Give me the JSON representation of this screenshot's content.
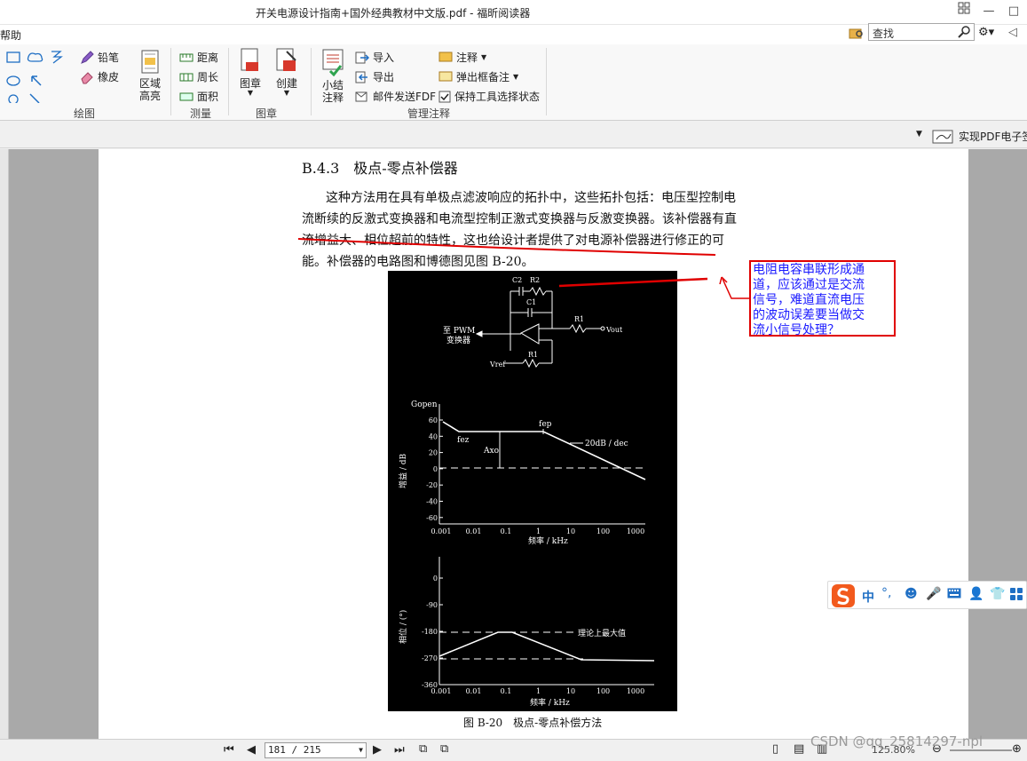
{
  "window": {
    "title": "开关电源设计指南+国外经典教材中文版.pdf - 福昕阅读器"
  },
  "menu": {
    "help": "帮助",
    "search_text": "查找"
  },
  "ribbon": {
    "draw_group": {
      "label": "绘图",
      "pencil": "铅笔",
      "eraser": "橡皮",
      "area_highlight": "区域\n高亮"
    },
    "measure_group": {
      "label": "测量",
      "distance": "距离",
      "perimeter": "周长",
      "area": "面积"
    },
    "stamp_group": {
      "label": "图章",
      "stamp": "图章",
      "create": "创建"
    },
    "manage_group": {
      "label": "管理注释",
      "summary": "小结\n注释",
      "import": "导入",
      "export": "导出",
      "send_email": "邮件发送FDF",
      "comment": "注释",
      "popup_note": "弹出框备注",
      "keep_tool": "保持工具选择状态"
    }
  },
  "toolbar2": {
    "sign_label": "实现PDF电子签"
  },
  "document": {
    "heading": "B.4.3　极点-零点补偿器",
    "paragraph_lines": [
      "这种方法用在具有单极点滤波响应的拓扑中，这些拓扑包括：电压型控制电",
      "流断续的反激式变换器和电流型控制正激式变换器与反激变换器。该补偿器有直",
      "流增益大、相位超前的特性，这也给设计者提供了对电源补偿器进行修正的可",
      "能。补偿器的电路图和博德图见图 B-20。"
    ],
    "figure_caption": "图 B-20　极点-零点补偿方法"
  },
  "figure": {
    "circuit": {
      "labels": {
        "c2": "C2",
        "r2": "R2",
        "c1": "C1",
        "r1": "R1",
        "r1b": "R1",
        "vout": "Vout",
        "vref": "Vref",
        "to_pwm": "至 PWM",
        "converter": "变换器"
      }
    },
    "gain_plot": {
      "ylabel": "增益 / dB",
      "xlabel": "频率 / kHz",
      "g_label": "Gopen",
      "fez": "fez",
      "fep": "fep",
      "axo": "Axo",
      "slope": "20dB / dec",
      "yticks": [
        "60",
        "40",
        "20",
        "0",
        "-20",
        "-40",
        "-60"
      ],
      "xticks": [
        "0.001",
        "0.01",
        "0.1",
        "1",
        "10",
        "100",
        "1000"
      ]
    },
    "phase_plot": {
      "ylabel": "相位 / (°)",
      "xlabel": "频率 / kHz",
      "theory_label": "理论上最大值",
      "yticks": [
        "0",
        "-90",
        "-180",
        "-270",
        "-360"
      ],
      "xticks": [
        "0.001",
        "0.01",
        "0.1",
        "1",
        "10",
        "100",
        "1000"
      ]
    }
  },
  "annotation": {
    "note_text": "电阻电容串联形成通道，应该通过是交流信号，难道直流电压的波动误差要当做交流小信号处理？",
    "note_lines": [
      "电阻电容串联形成通",
      "道，应该通过是交流",
      "信号，难道直流电压",
      "的波动误差要当做交",
      "流小信号处理？"
    ],
    "color": "#e00000",
    "text_color": "#1a1aff"
  },
  "statusbar": {
    "page_value": "181 / 215",
    "zoom": "125.80%"
  },
  "ime": {
    "label": "中"
  },
  "watermark": "CSDN @qq_25814297-npl"
}
